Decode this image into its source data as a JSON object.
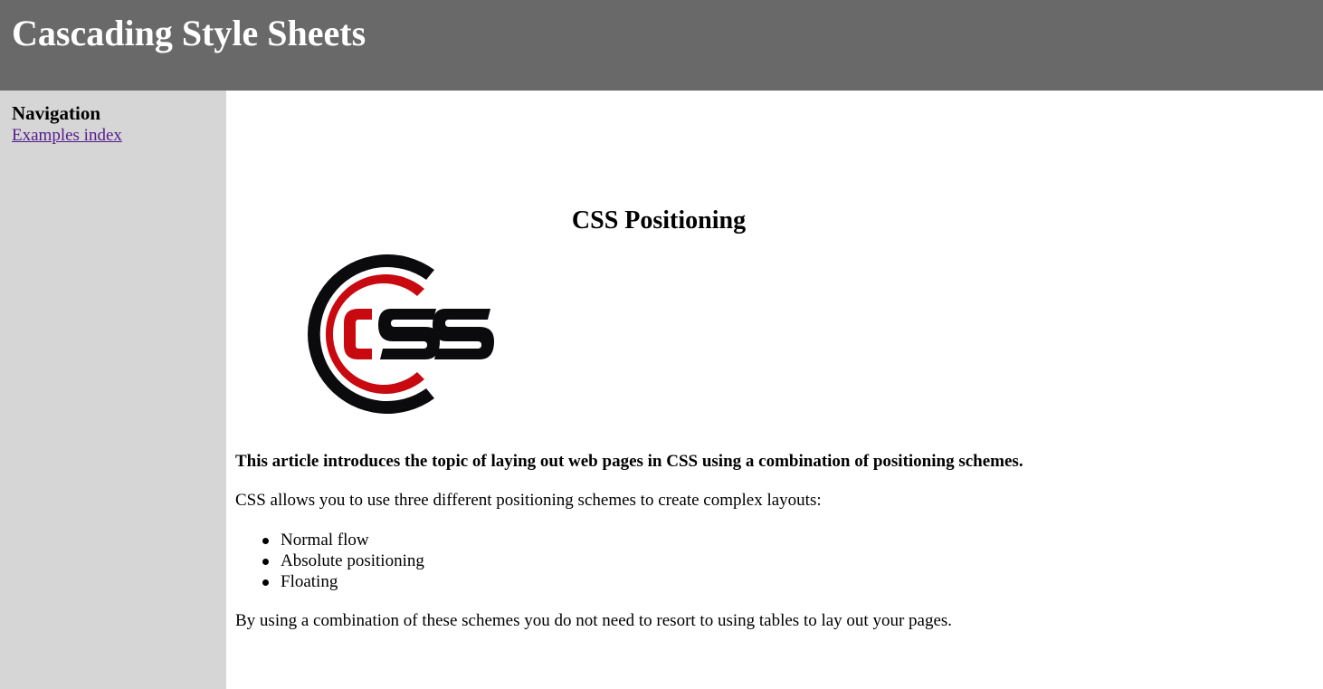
{
  "header": {
    "title": "Cascading Style Sheets"
  },
  "sidebar": {
    "heading": "Navigation",
    "link": "Examples index"
  },
  "main": {
    "title": "CSS Positioning",
    "logo": {
      "text": "CSS",
      "icon": "css-logo-icon",
      "colors": {
        "dark": "#0b0b0d",
        "red": "#c8090f"
      }
    },
    "intro": "This article introduces the topic of laying out web pages in CSS using a combination of positioning schemes.",
    "paragraph1": "CSS allows you to use three different positioning schemes to create complex layouts:",
    "list": [
      "Normal flow",
      "Absolute positioning",
      "Floating"
    ],
    "paragraph2": "By using a combination of these schemes you do not need to resort to using tables to lay out your pages."
  },
  "colors": {
    "header_bg": "#696969",
    "sidebar_bg": "#d6d6d6",
    "link": "#551a8b"
  }
}
